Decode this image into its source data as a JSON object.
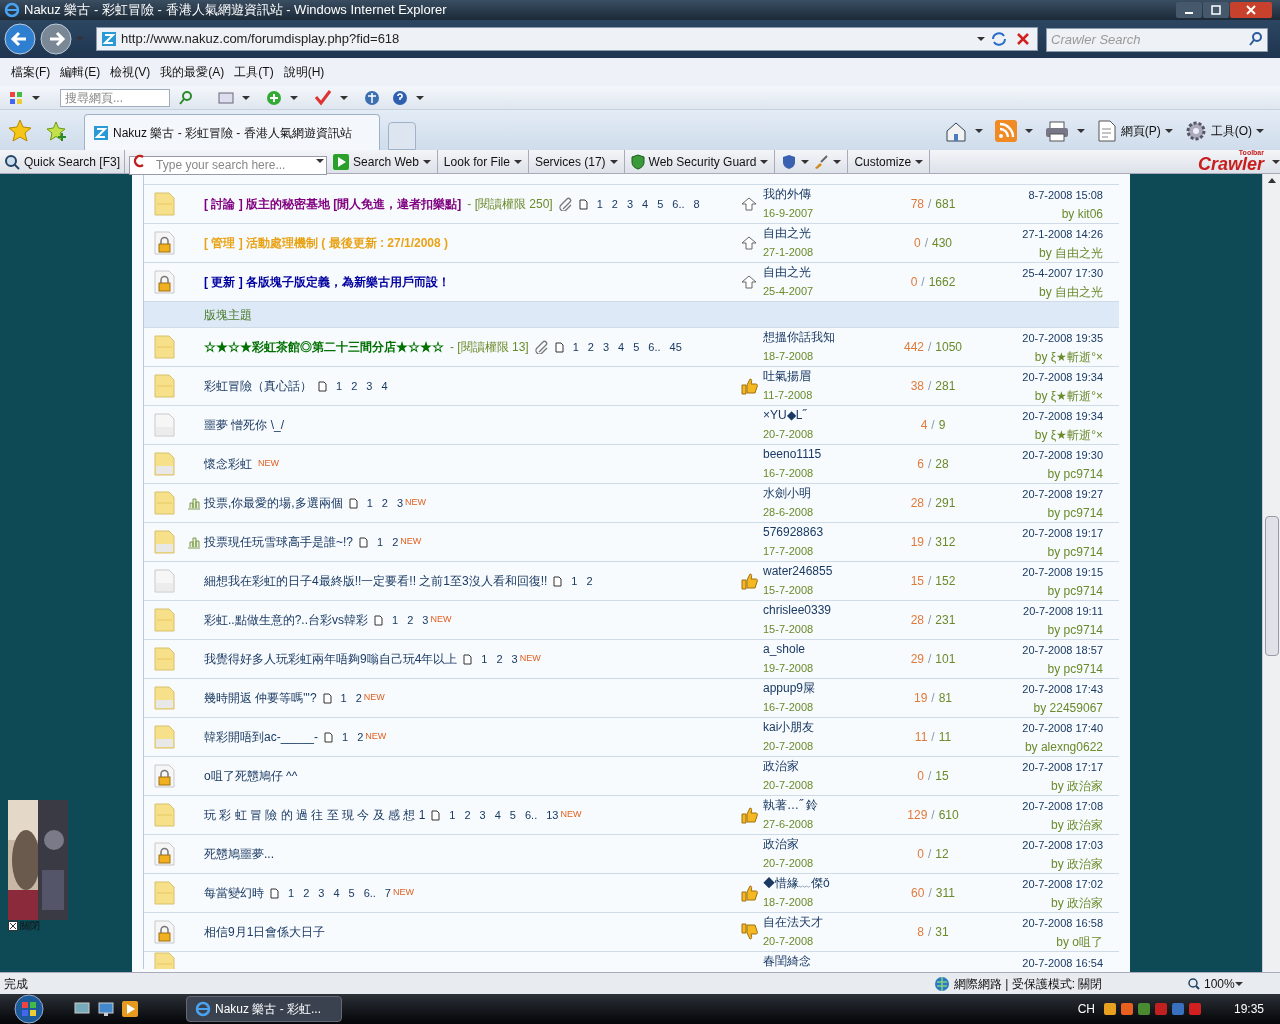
{
  "window": {
    "title": "Nakuz 樂古 - 彩虹冒險 - 香港人氣網遊資訊站 - Windows Internet Explorer"
  },
  "address_bar": {
    "url": "http://www.nakuz.com/forumdisplay.php?fid=618"
  },
  "search_box": {
    "placeholder": "Crawler Search"
  },
  "menu": [
    "檔案(F)",
    "編輯(E)",
    "檢視(V)",
    "我的最愛(A)",
    "工具(T)",
    "說明(H)"
  ],
  "command_bar": {
    "search_placeholder": "搜尋網頁..."
  },
  "tabs": [
    {
      "label": "Nakuz 樂古 - 彩虹冒險 - 香港人氣網遊資訊站",
      "selected": true
    }
  ],
  "tab_tools": [
    "網頁(P)",
    "工具(O)"
  ],
  "crawler_toolbar": {
    "quick_search": "Quick Search [F3]",
    "search_placeholder": "Type your search here...",
    "buttons": [
      "Search Web",
      "Look for File",
      "Services (17)",
      "Web Security Guard",
      "Customize"
    ],
    "logo": "Crawler",
    "logo_badge": "Toolbar"
  },
  "ad": {
    "kind": "picture",
    "close_label": "關閉"
  },
  "stat_separator": "/",
  "threads": [
    {
      "kind": "topic",
      "folder": {
        "kind": "hot"
      },
      "poll": false,
      "title": "[ 討論 ] 版主的秘密基地 [閒人免進，違者扣樂點]",
      "color": "#800080",
      "bold": true,
      "perm": "- [閱讀權限 250]",
      "attachment": true,
      "pages": [
        "1",
        "2",
        "3",
        "4",
        "5",
        "6..",
        "8"
      ],
      "mood": {
        "kind": "sticky"
      },
      "author": "我的外傳",
      "date": "16-9-2007",
      "replies": "78",
      "views": "681",
      "last_time": "8-7-2008 15:08",
      "last_by": "by kit06"
    },
    {
      "kind": "topic",
      "folder": {
        "kind": "locked"
      },
      "poll": false,
      "title": "[ 管理 ] 活動處理機制 ( 最後更新 : 27/1/2008 )",
      "color": "#e8a317",
      "bold": true,
      "attachment": false,
      "mood": {
        "kind": "sticky"
      },
      "author": "自由之光",
      "date": "27-1-2008",
      "replies": "0",
      "views": "430",
      "last_time": "27-1-2008 14:26",
      "last_by": "by 自由之光"
    },
    {
      "kind": "topic",
      "folder": {
        "kind": "locked"
      },
      "poll": false,
      "title": "[ 更新 ] 各版塊子版定義，為新樂古用戶而設！",
      "color": "#0000a0",
      "bold": true,
      "attachment": false,
      "mood": {
        "kind": "sticky"
      },
      "author": "自由之光",
      "date": "25-4-2007",
      "replies": "0",
      "views": "1662",
      "last_time": "25-4-2007 17:30",
      "last_by": "by 自由之光"
    },
    {
      "kind": "section",
      "title": "版塊主題"
    },
    {
      "kind": "topic",
      "folder": {
        "kind": "hot"
      },
      "poll": false,
      "title": "☆★☆★彩虹茶館◎第二十三間分店★☆★☆",
      "color": "#007000",
      "bold": true,
      "perm": "- [閱讀權限 13]",
      "attachment": true,
      "pages": [
        "1",
        "2",
        "3",
        "4",
        "5",
        "6..",
        "45"
      ],
      "author": "想搵你話我知",
      "date": "18-7-2008",
      "replies": "442",
      "views": "1050",
      "last_time": "20-7-2008 19:35",
      "last_by": "by ξ★斬逝°×"
    },
    {
      "kind": "topic",
      "folder": {
        "kind": "hot"
      },
      "poll": false,
      "title": "彩虹冒險（真心話）",
      "bold": false,
      "attachment": false,
      "pages": [
        "1",
        "2",
        "3",
        "4"
      ],
      "mood": {
        "kind": "thumbs-up"
      },
      "author": "吐氣揚眉",
      "date": "11-7-2008",
      "replies": "38",
      "views": "281",
      "last_time": "20-7-2008 19:34",
      "last_by": "by ξ★斬逝°×"
    },
    {
      "kind": "topic",
      "folder": {
        "kind": "plain"
      },
      "poll": false,
      "title": "噩夢 憎死你 \\_/",
      "bold": false,
      "attachment": false,
      "author": "×YU◆L˝",
      "date": "20-7-2008",
      "replies": "4",
      "views": "9",
      "last_time": "20-7-2008 19:34",
      "last_by": "by ξ★斬逝°×"
    },
    {
      "kind": "topic",
      "folder": {
        "kind": "new"
      },
      "poll": false,
      "title": "懷念彩虹",
      "bold": false,
      "attachment": false,
      "new": "NEW",
      "author": "beeno1115",
      "date": "16-7-2008",
      "replies": "6",
      "views": "28",
      "last_time": "20-7-2008 19:30",
      "last_by": "by pc9714"
    },
    {
      "kind": "topic",
      "folder": {
        "kind": "hot"
      },
      "poll": true,
      "title": "投票,你最愛的場,多選兩個",
      "bold": false,
      "attachment": false,
      "pages": [
        "1",
        "2",
        "3"
      ],
      "new": "NEW",
      "author": "水劍小明",
      "date": "28-6-2008",
      "replies": "28",
      "views": "291",
      "last_time": "20-7-2008 19:27",
      "last_by": "by pc9714"
    },
    {
      "kind": "topic",
      "folder": {
        "kind": "new"
      },
      "poll": true,
      "title": "投票現任玩雪球高手是誰~!?",
      "bold": false,
      "attachment": false,
      "pages": [
        "1",
        "2"
      ],
      "new": "NEW",
      "author": "576928863",
      "date": "17-7-2008",
      "replies": "19",
      "views": "312",
      "last_time": "20-7-2008 19:17",
      "last_by": "by pc9714"
    },
    {
      "kind": "topic",
      "folder": {
        "kind": "plain"
      },
      "poll": false,
      "title": "細想我在彩虹的日子4最終版!!一定要看!! 之前1至3沒人看和回復!!",
      "bold": false,
      "attachment": false,
      "pages": [
        "1",
        "2"
      ],
      "mood": {
        "kind": "thumbs-up"
      },
      "author": "water246855",
      "date": "15-7-2008",
      "replies": "15",
      "views": "152",
      "last_time": "20-7-2008 19:15",
      "last_by": "by pc9714"
    },
    {
      "kind": "topic",
      "folder": {
        "kind": "hot"
      },
      "poll": false,
      "title": "彩虹..點做生意的?..台彩vs韓彩",
      "bold": false,
      "attachment": false,
      "pages": [
        "1",
        "2",
        "3"
      ],
      "new": "NEW",
      "author": "chrislee0339",
      "date": "15-7-2008",
      "replies": "28",
      "views": "231",
      "last_time": "20-7-2008 19:11",
      "last_by": "by pc9714"
    },
    {
      "kind": "topic",
      "folder": {
        "kind": "hot"
      },
      "poll": false,
      "title": "我覺得好多人玩彩虹兩年唔夠9嗡自己玩4年以上",
      "bold": false,
      "attachment": false,
      "pages": [
        "1",
        "2",
        "3"
      ],
      "new": "NEW",
      "author": "a_shole",
      "date": "19-7-2008",
      "replies": "29",
      "views": "101",
      "last_time": "20-7-2008 18:57",
      "last_by": "by pc9714"
    },
    {
      "kind": "topic",
      "folder": {
        "kind": "new"
      },
      "poll": false,
      "title": "幾時開返 仲要等嗎\"'?",
      "bold": false,
      "attachment": false,
      "pages": [
        "1",
        "2"
      ],
      "new": "NEW",
      "author": "appup9屎",
      "date": "16-7-2008",
      "replies": "19",
      "views": "81",
      "last_time": "20-7-2008 17:43",
      "last_by": "by 22459067"
    },
    {
      "kind": "topic",
      "folder": {
        "kind": "new"
      },
      "poll": false,
      "title": "韓彩開唔到ac-_____-",
      "bold": false,
      "attachment": false,
      "pages": [
        "1",
        "2"
      ],
      "new": "NEW",
      "author": "kai小朋友",
      "date": "20-7-2008",
      "replies": "11",
      "views": "11",
      "last_time": "20-7-2008 17:40",
      "last_by": "by alexng0622"
    },
    {
      "kind": "topic",
      "folder": {
        "kind": "locked"
      },
      "poll": false,
      "title": "o咀了死戇鳩仔 ^^",
      "bold": false,
      "attachment": false,
      "author": "政治家",
      "date": "20-7-2008",
      "replies": "0",
      "views": "15",
      "last_time": "20-7-2008 17:17",
      "last_by": "by 政治家"
    },
    {
      "kind": "topic",
      "folder": {
        "kind": "hot"
      },
      "poll": false,
      "title": "玩 彩 虹 冒 險 的 過 往 至 現 今 及 感 想 1",
      "bold": false,
      "attachment": false,
      "pages": [
        "1",
        "2",
        "3",
        "4",
        "5",
        "6..",
        "13"
      ],
      "new": "NEW",
      "mood": {
        "kind": "thumbs-up"
      },
      "author": "執著…˝ 鈴",
      "date": "27-6-2008",
      "replies": "129",
      "views": "610",
      "last_time": "20-7-2008 17:08",
      "last_by": "by 政治家"
    },
    {
      "kind": "topic",
      "folder": {
        "kind": "locked"
      },
      "poll": false,
      "title": "死戇鳩噩夢...",
      "bold": false,
      "attachment": false,
      "author": "政治家",
      "date": "20-7-2008",
      "replies": "0",
      "views": "12",
      "last_time": "20-7-2008 17:03",
      "last_by": "by 政治家"
    },
    {
      "kind": "topic",
      "folder": {
        "kind": "hot"
      },
      "poll": false,
      "title": "每當變幻時",
      "bold": false,
      "attachment": false,
      "pages": [
        "1",
        "2",
        "3",
        "4",
        "5",
        "6..",
        "7"
      ],
      "new": "NEW",
      "mood": {
        "kind": "thumbs-up"
      },
      "author": "◆惜緣﹏傑ǒ",
      "date": "18-7-2008",
      "replies": "60",
      "views": "311",
      "last_time": "20-7-2008 17:02",
      "last_by": "by 政治家"
    },
    {
      "kind": "topic",
      "folder": {
        "kind": "locked"
      },
      "poll": false,
      "title": "相信9月1日會係大日子",
      "bold": false,
      "attachment": false,
      "mood": {
        "kind": "thumbs-down"
      },
      "author": "自在法天才",
      "date": "20-7-2008",
      "replies": "8",
      "views": "31",
      "last_time": "20-7-2008 16:58",
      "last_by": "by o咀了"
    },
    {
      "kind": "partial",
      "folder": {
        "kind": "hot"
      },
      "author": "春閨綺念",
      "last_time": "20-7-2008 16:54"
    }
  ],
  "status_bar": {
    "text": "完成",
    "zone": "網際網路 | 受保護模式: 關閉",
    "zoom": "100%"
  },
  "taskbar": {
    "window_button": "Nakuz 樂古 - 彩虹...",
    "language": "CH",
    "clock": "19:35"
  }
}
